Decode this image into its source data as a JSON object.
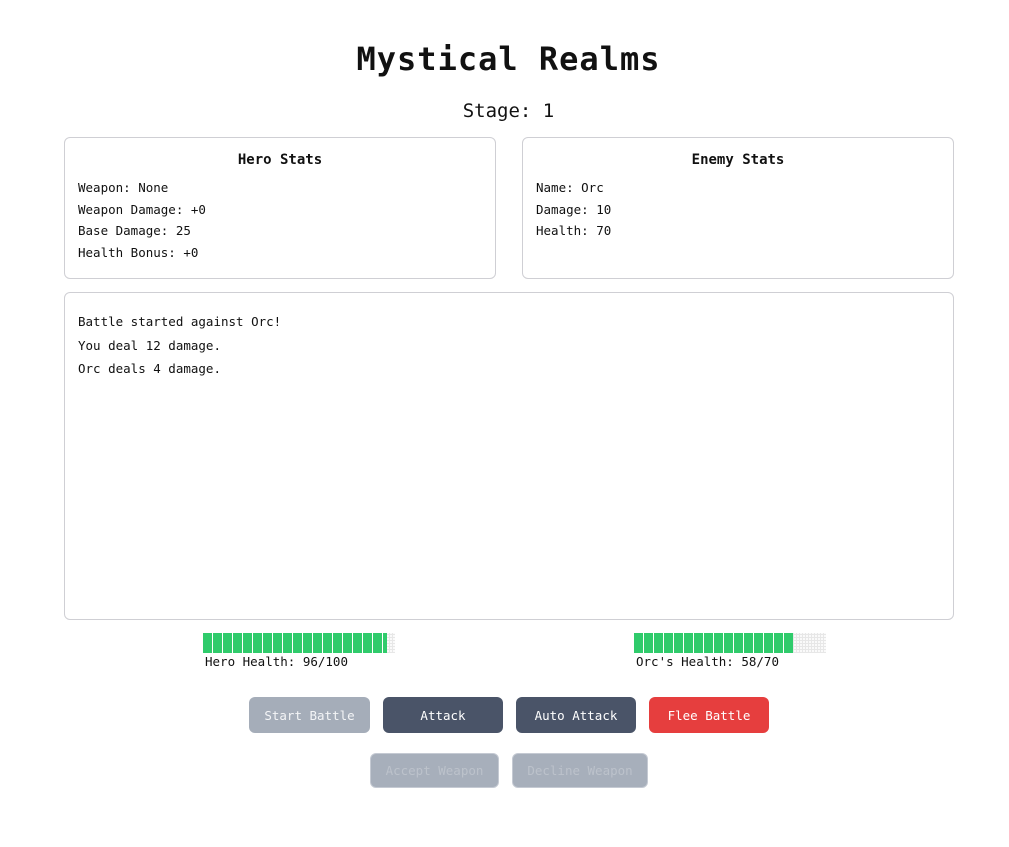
{
  "game": {
    "title": "Mystical Realms",
    "stage_label": "Stage: 1",
    "stage": 1
  },
  "hero_stats": {
    "title": "Hero Stats",
    "lines": [
      "Weapon: None",
      "Weapon Damage: +0",
      "Base Damage: 25",
      "Health Bonus: +0"
    ]
  },
  "enemy_stats": {
    "title": "Enemy Stats",
    "lines": [
      "Name: Orc",
      "Damage: 10",
      "Health: 70"
    ]
  },
  "battle_log": [
    "Battle started against Orc!",
    "You deal 12 damage.",
    "Orc deals 4 damage."
  ],
  "hero_health": {
    "label": "Hero Health: 96/100",
    "current": 96,
    "max": 100,
    "fill_color": "#2fcb6b"
  },
  "enemy_health": {
    "label": "Orc's Health: 58/70",
    "current": 58,
    "max": 70,
    "fill_color": "#2fcb6b"
  },
  "buttons": {
    "start_battle": "Start Battle",
    "attack": "Attack",
    "auto_attack": "Auto Attack",
    "flee_battle": "Flee Battle",
    "accept_weapon": "Accept Weapon",
    "decline_weapon": "Decline Weapon"
  },
  "colors": {
    "primary_button": "#4a5468",
    "danger_button": "#e63e3e",
    "disabled_button": "#a7afbb",
    "health_fill": "#2fcb6b"
  }
}
